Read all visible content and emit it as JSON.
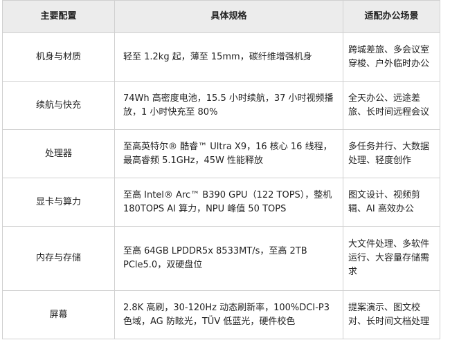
{
  "table": {
    "headers": [
      "主要配置",
      "具体规格",
      "适配办公场景"
    ],
    "rows": [
      {
        "category": "机身与材质",
        "spec": "轻至 1.2kg 起，薄至 15mm，碳纤维增强机身",
        "scenario": "跨城差旅、多会议室穿梭、户外临时办公"
      },
      {
        "category": "续航与快充",
        "spec": "74Wh 高密度电池，15.5 小时续航，37 小时视频播放，1 小时快充至 80%",
        "scenario": "全天办公、远途差旅、长时间远程会议"
      },
      {
        "category": "处理器",
        "spec": "至高英特尔® 酷睿™ Ultra X9，16 核心 16 线程，最高睿频 5.1GHz，45W 性能释放",
        "scenario": "多任务并行、大数据处理、轻度创作"
      },
      {
        "category": "显卡与算力",
        "spec": "至高 Intel® Arc™ B390 GPU（122 TOPS），整机 180TOPS AI 算力，NPU 峰值 50 TOPS",
        "scenario": "图文设计、视频剪辑、AI 高效办公"
      },
      {
        "category": "内存与存储",
        "spec": "至高 64GB LPDDR5x 8533MT/s，至高 2TB PCle5.0，双硬盘位",
        "scenario": "大文件处理、多软件运行、大容量存储需求"
      },
      {
        "category": "屏幕",
        "spec": "2.8K 高刷，30-120Hz 动态刷新率，100%DCI-P3 色域，AG 防眩光，TÜV 低蓝光，硬件校色",
        "scenario": "提案演示、图文校对、长时间文档处理"
      }
    ]
  }
}
